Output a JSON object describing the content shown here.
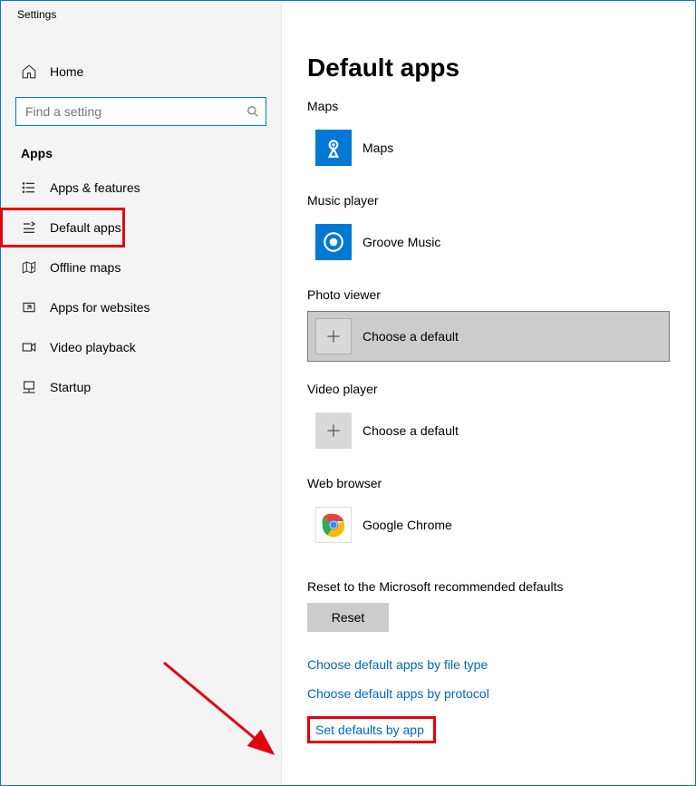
{
  "window_title": "Settings",
  "sidebar": {
    "home_label": "Home",
    "search_placeholder": "Find a setting",
    "section_title": "Apps",
    "items": [
      {
        "label": "Apps & features"
      },
      {
        "label": "Default apps"
      },
      {
        "label": "Offline maps"
      },
      {
        "label": "Apps for websites"
      },
      {
        "label": "Video playback"
      },
      {
        "label": "Startup"
      }
    ]
  },
  "main": {
    "title": "Default apps",
    "categories": {
      "maps": {
        "label": "Maps",
        "app": "Maps"
      },
      "music": {
        "label": "Music player",
        "app": "Groove Music"
      },
      "photo": {
        "label": "Photo viewer",
        "app": "Choose a default"
      },
      "video": {
        "label": "Video player",
        "app": "Choose a default"
      },
      "web": {
        "label": "Web browser",
        "app": "Google Chrome"
      }
    },
    "reset_text": "Reset to the Microsoft recommended defaults",
    "reset_button": "Reset",
    "links": {
      "by_file_type": "Choose default apps by file type",
      "by_protocol": "Choose default apps by protocol",
      "by_app": "Set defaults by app"
    }
  }
}
